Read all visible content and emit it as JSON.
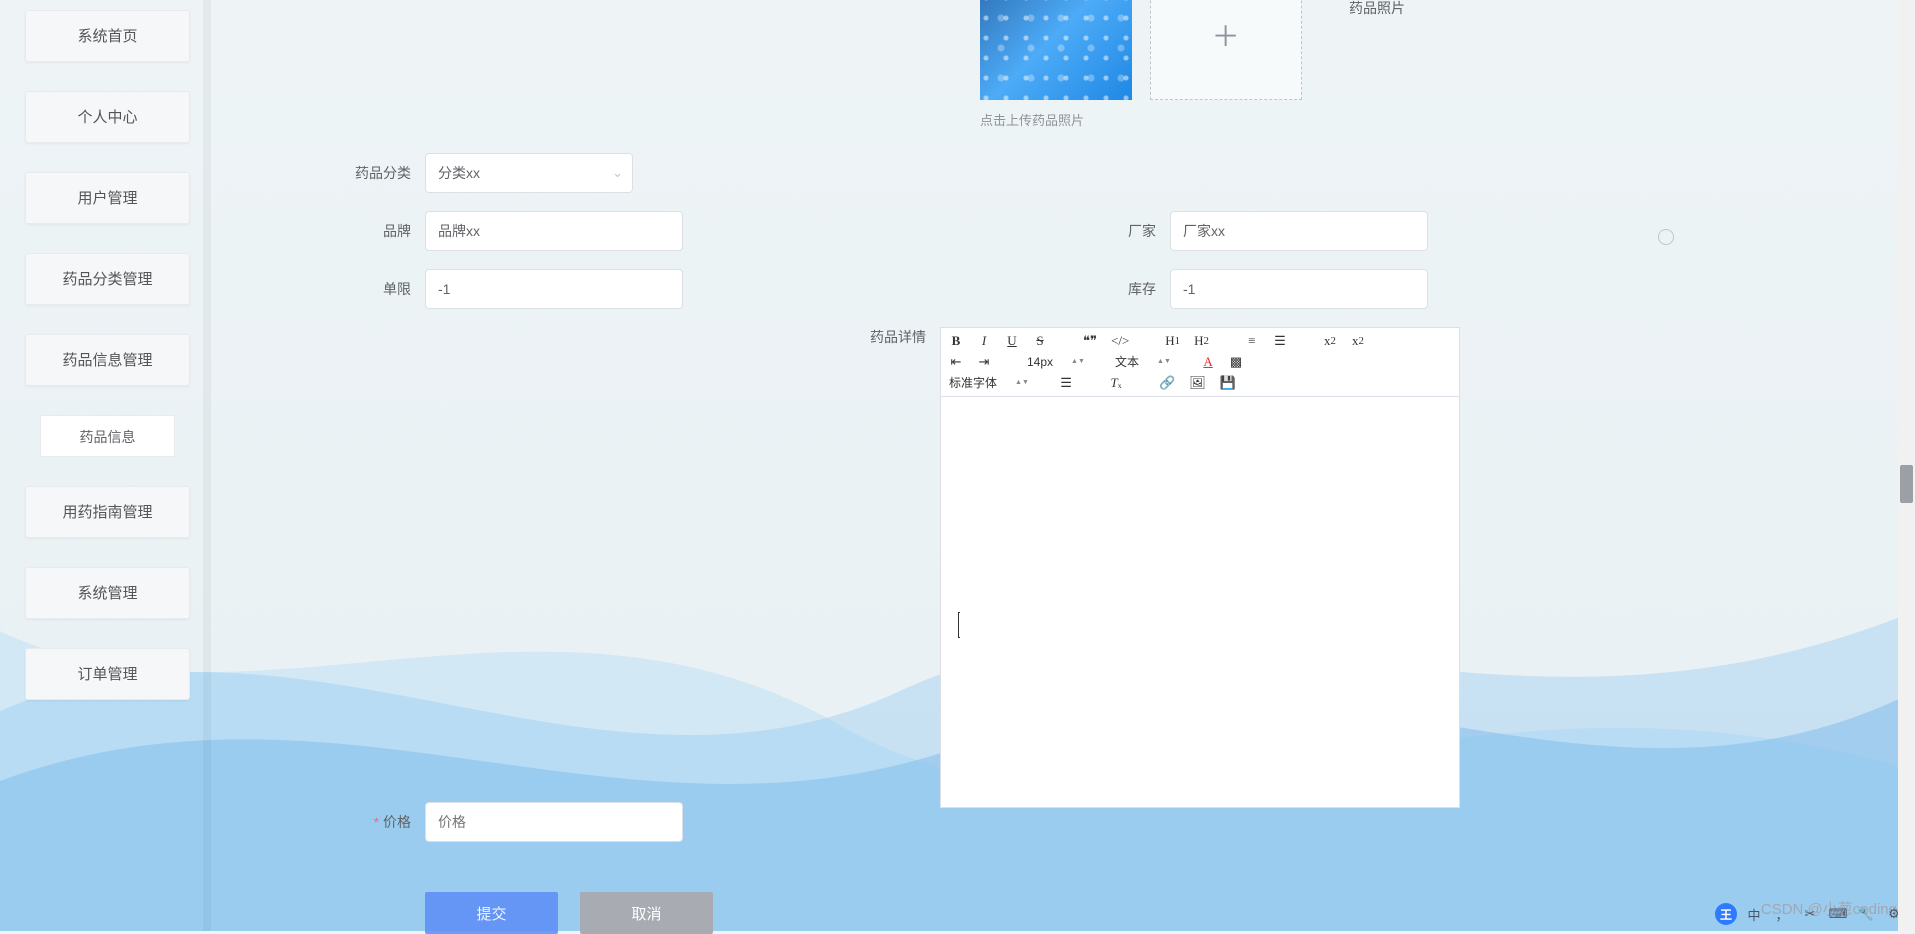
{
  "sidebar": {
    "items": [
      {
        "label": "系统首页"
      },
      {
        "label": "个人中心"
      },
      {
        "label": "用户管理"
      },
      {
        "label": "药品分类管理"
      },
      {
        "label": "药品信息管理"
      },
      {
        "label": "用药指南管理"
      },
      {
        "label": "系统管理"
      },
      {
        "label": "订单管理"
      }
    ],
    "sub": {
      "label": "药品信息"
    }
  },
  "form": {
    "photo_label": "药品照片",
    "upload_hint": "点击上传药品照片",
    "category_label": "药品分类",
    "category_value": "分类xx",
    "brand_label": "品牌",
    "brand_value": "品牌xx",
    "manufacturer_label": "厂家",
    "manufacturer_value": "厂家xx",
    "limit_label": "单限",
    "limit_value": "-1",
    "stock_label": "库存",
    "stock_value": "-1",
    "detail_label": "药品详情",
    "price_label": "价格",
    "price_placeholder": "价格",
    "price_value": ""
  },
  "editor": {
    "font_size": "14px",
    "text_style": "文本",
    "font_family": "标准字体"
  },
  "buttons": {
    "submit": "提交",
    "cancel": "取消"
  },
  "watermark": "CSDN @小葱coding",
  "taskbar": {
    "ime_badge": "王",
    "ime_lang": "中"
  }
}
